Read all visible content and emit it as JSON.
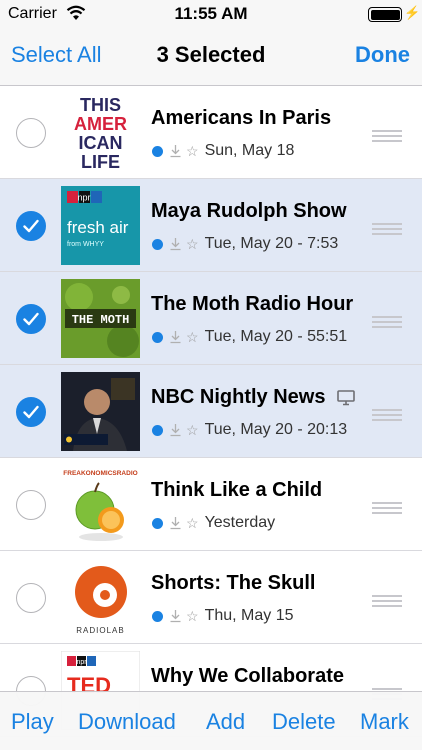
{
  "status": {
    "carrier": "Carrier",
    "time": "11:55 AM"
  },
  "nav": {
    "select_all": "Select All",
    "title": "3 Selected",
    "done": "Done"
  },
  "episodes": [
    {
      "title": "Americans In Paris",
      "date": "Sun, May 18",
      "selected": false,
      "art": "this-american-life"
    },
    {
      "title": "Maya Rudolph Show",
      "date": "Tue, May 20 - 7:53",
      "selected": true,
      "art": "fresh-air",
      "art_text": {
        "badge": "npr",
        "main": "fresh air",
        "sub": "from WHYY"
      }
    },
    {
      "title": "The Moth Radio Hour",
      "date": "Tue, May 20 - 55:51",
      "selected": true,
      "art": "the-moth",
      "art_text": {
        "main": "THE MOTH"
      }
    },
    {
      "title": "NBC Nightly News",
      "date": "Tue, May 20 - 20:13",
      "selected": true,
      "art": "nbc-nightly-news",
      "video": true
    },
    {
      "title": "Think Like a Child",
      "date": "Yesterday",
      "selected": false,
      "art": "freakonomics",
      "art_text": {
        "main": "FREAKONOMICSRADIO"
      }
    },
    {
      "title": "Shorts: The Skull",
      "date": "Thu, May 15",
      "selected": false,
      "art": "radiolab",
      "art_text": {
        "main": "RADIOLAB"
      }
    },
    {
      "title": "Why We Collaborate",
      "date": "",
      "selected": false,
      "art": "ted",
      "art_text": {
        "badge": "npr",
        "main": "TED"
      }
    }
  ],
  "toolbar": {
    "play": "Play",
    "download": "Download",
    "add": "Add",
    "delete": "Delete",
    "mark": "Mark"
  },
  "colors": {
    "accent": "#1a82e2",
    "selected_row": "#e1e8f5"
  }
}
